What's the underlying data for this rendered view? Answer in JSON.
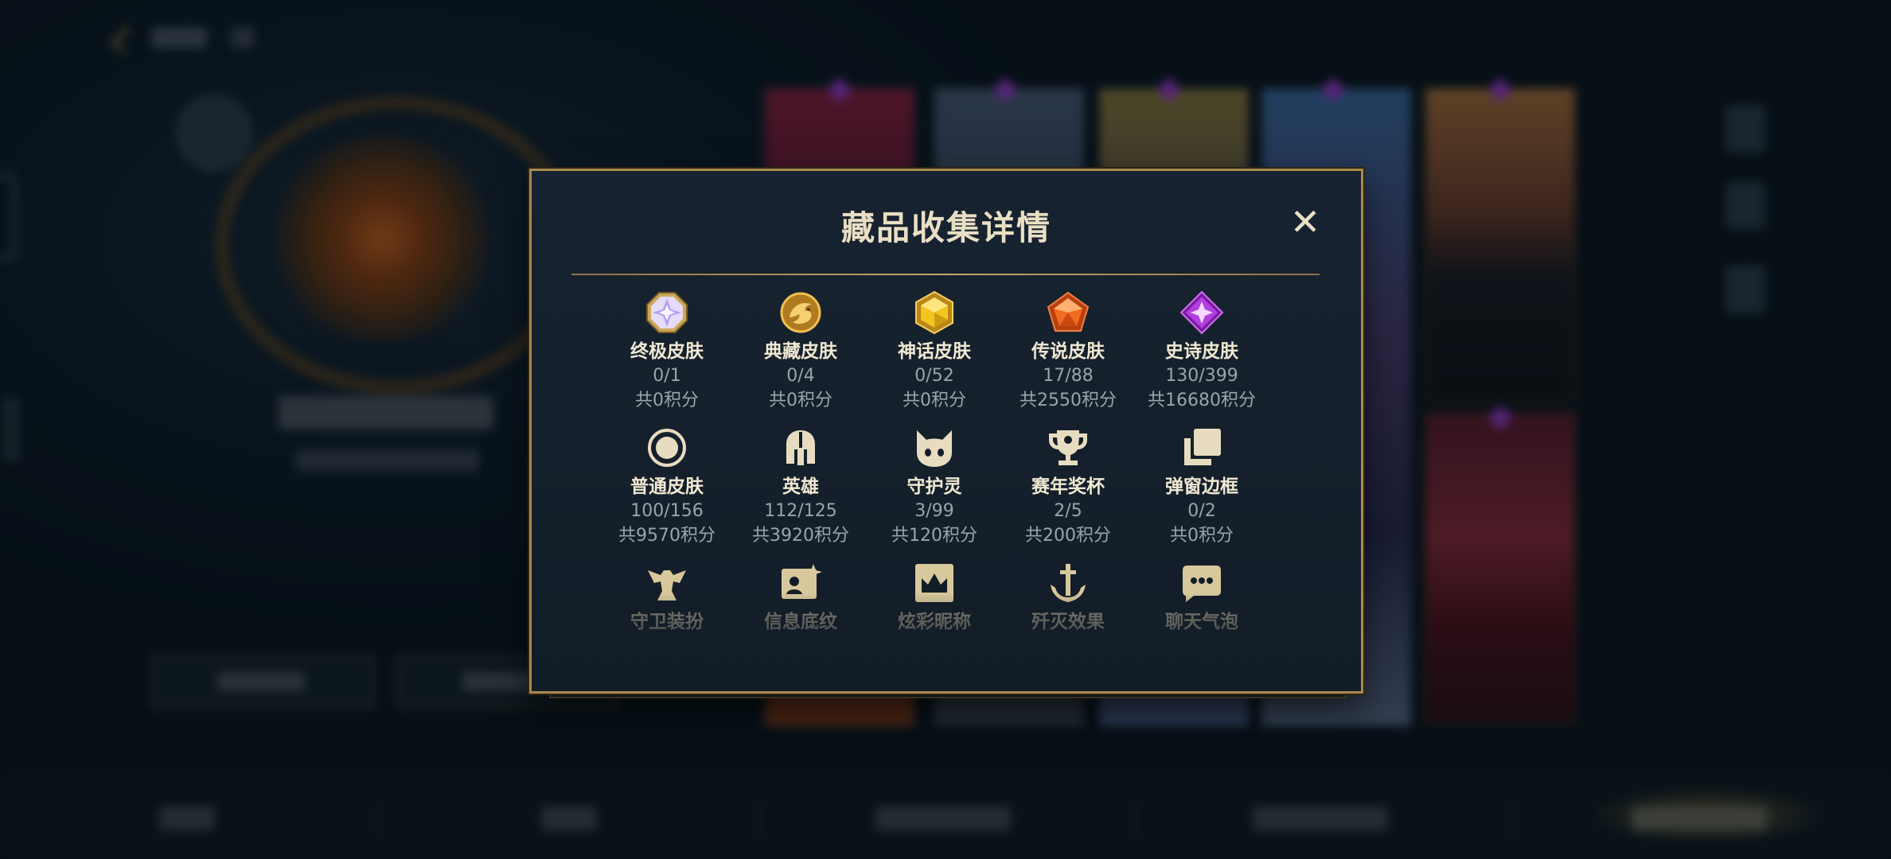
{
  "modal": {
    "title": "藏品收集详情",
    "close_symbol": "✕"
  },
  "categories": [
    {
      "label": "终极皮肤",
      "count": "0/1",
      "points": "共0积分",
      "icon": "octagon-gem-icon",
      "color": "#b89cf0"
    },
    {
      "label": "典藏皮肤",
      "count": "0/4",
      "points": "共0积分",
      "icon": "dragon-medal-icon",
      "color": "#d9a23a"
    },
    {
      "label": "神话皮肤",
      "count": "0/52",
      "points": "共0积分",
      "icon": "hexagon-gem-icon",
      "color": "#e6b82a"
    },
    {
      "label": "传说皮肤",
      "count": "17/88",
      "points": "共2550积分",
      "icon": "pentagon-gem-icon",
      "color": "#e06020"
    },
    {
      "label": "史诗皮肤",
      "count": "130/399",
      "points": "共16680积分",
      "icon": "diamond-gem-icon",
      "color": "#b040e0"
    },
    {
      "label": "普通皮肤",
      "count": "100/156",
      "points": "共9570积分",
      "icon": "ring-icon",
      "color": "#e8dcc0"
    },
    {
      "label": "英雄",
      "count": "112/125",
      "points": "共3920积分",
      "icon": "helmet-icon",
      "color": "#e8dcc0"
    },
    {
      "label": "守护灵",
      "count": "3/99",
      "points": "共120积分",
      "icon": "spirit-cat-icon",
      "color": "#e8dcc0"
    },
    {
      "label": "赛年奖杯",
      "count": "2/5",
      "points": "共200积分",
      "icon": "trophy-icon",
      "color": "#e8dcc0"
    },
    {
      "label": "弹窗边框",
      "count": "0/2",
      "points": "共0积分",
      "icon": "stacked-frames-icon",
      "color": "#e8dcc0"
    },
    {
      "label": "守卫装扮",
      "icon": "guard-statue-icon",
      "color": "#d8c89c"
    },
    {
      "label": "信息底纹",
      "icon": "profile-card-icon",
      "color": "#d8c89c"
    },
    {
      "label": "炫彩昵称",
      "icon": "crown-frame-icon",
      "color": "#d8c89c"
    },
    {
      "label": "歼灭效果",
      "icon": "anchor-sword-icon",
      "color": "#d8c89c"
    },
    {
      "label": "聊天气泡",
      "icon": "chat-bubble-icon",
      "color": "#d8c89c"
    }
  ],
  "theme": {
    "accent_gold": "#a8894f",
    "text_light": "#f0e8d2",
    "text_muted": "#9aa4ac"
  }
}
